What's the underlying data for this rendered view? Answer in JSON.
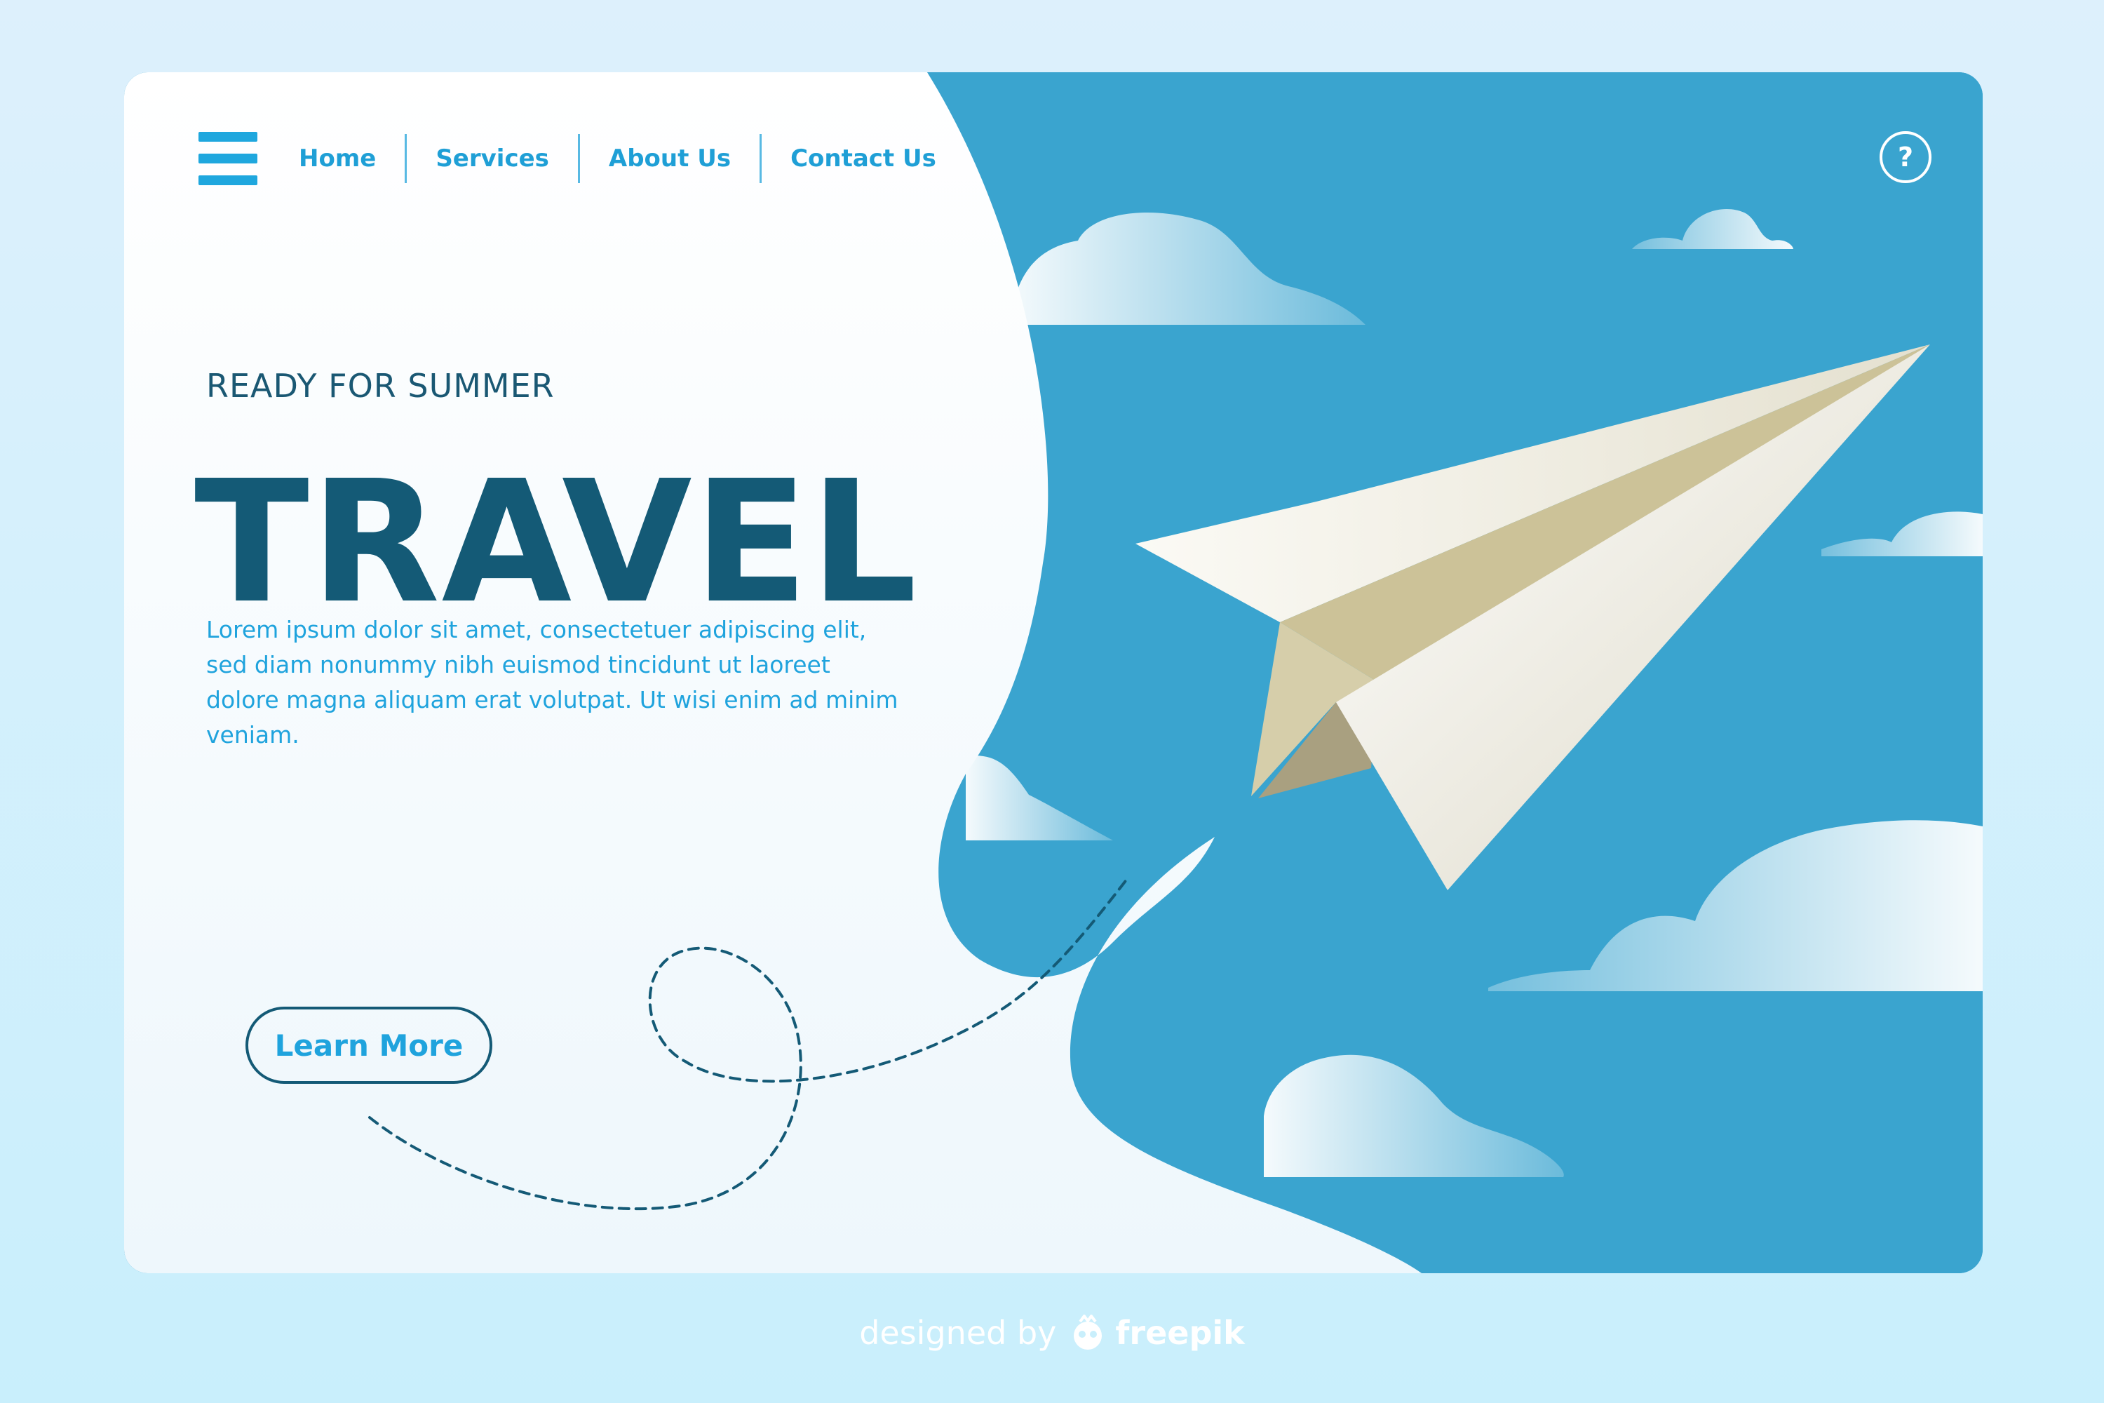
{
  "nav": {
    "menu_icon": "hamburger-icon",
    "items": [
      {
        "label": "Home"
      },
      {
        "label": "Services"
      },
      {
        "label": "About Us"
      },
      {
        "label": "Contact Us"
      }
    ]
  },
  "help": {
    "label": "?",
    "icon": "help-icon"
  },
  "hero": {
    "eyebrow": "READY FOR SUMMER",
    "title": "TRAVEL",
    "body": "Lorem ipsum dolor sit amet, consectetuer adipiscing elit, sed diam nonummy nibh euismod tincidunt ut laoreet dolore magna aliquam erat volutpat. Ut wisi enim ad minim veniam.",
    "cta_label": "Learn More"
  },
  "illustration": {
    "subject": "paper-plane-icon",
    "extras": [
      "cloud-icon",
      "dashed-flight-path"
    ]
  },
  "credit": {
    "prefix": "designed by",
    "brand": "freepik",
    "icon": "freepik-logo-icon"
  },
  "colors": {
    "page_background": "#d6effc",
    "panel_background": "#f4fafd",
    "sky": "#3aa4cf",
    "title": "#145a76",
    "accent": "#1fa3dd",
    "paper_plane": "#d6ceaa",
    "cloud": "#cfe9f4"
  }
}
